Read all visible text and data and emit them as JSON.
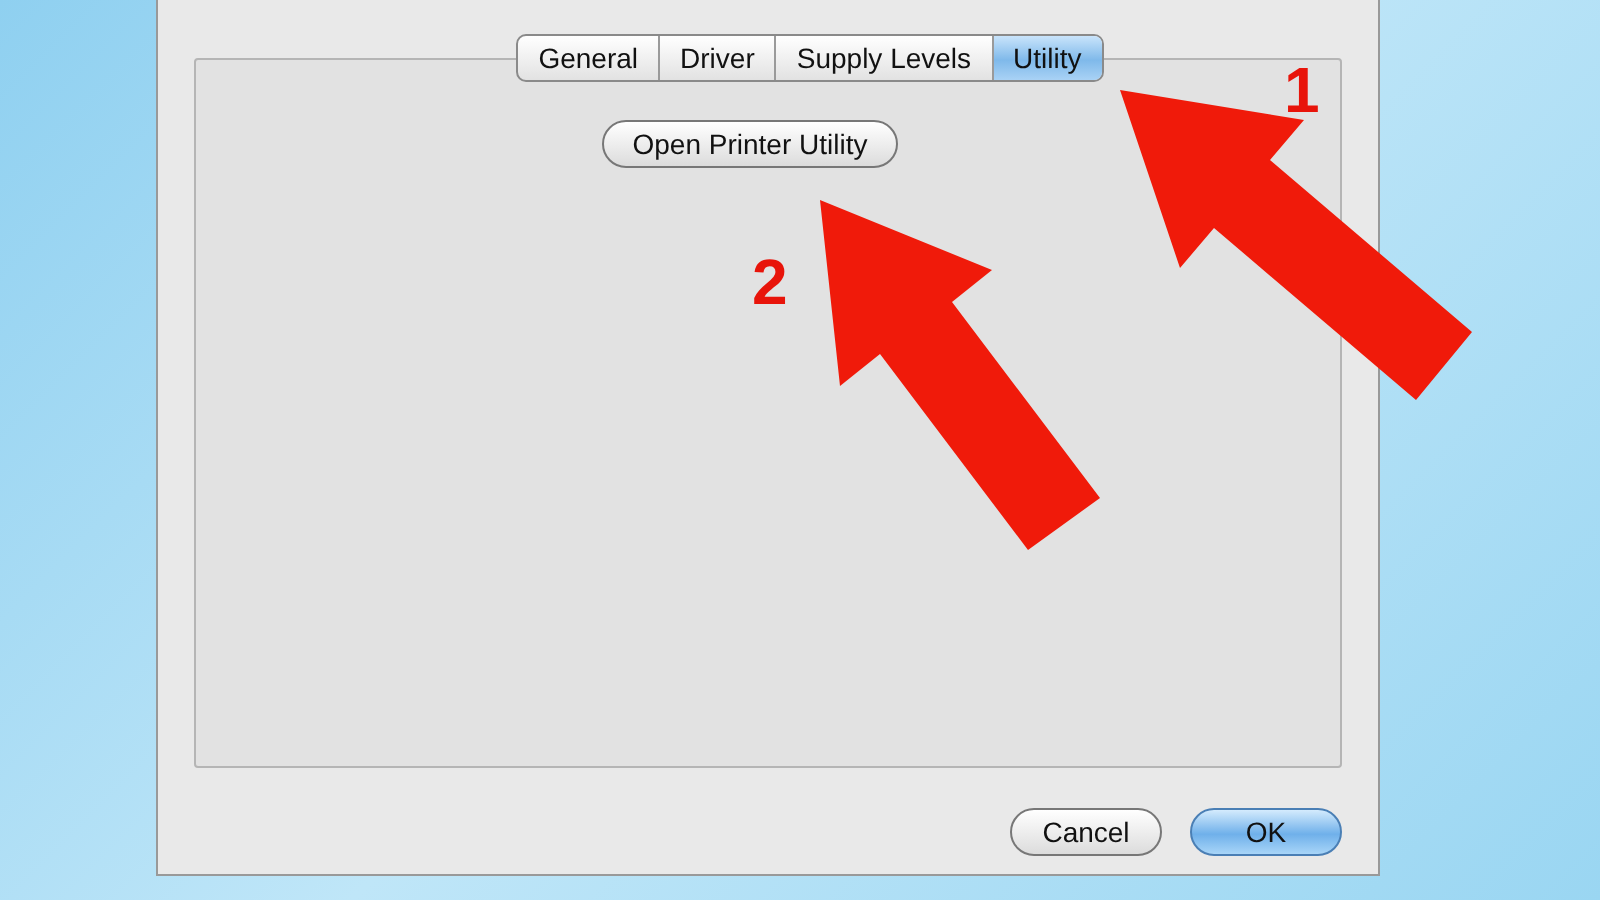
{
  "dialog": {
    "tabs": [
      {
        "label": "General",
        "selected": false
      },
      {
        "label": "Driver",
        "selected": false
      },
      {
        "label": "Supply Levels",
        "selected": false
      },
      {
        "label": "Utility",
        "selected": true
      }
    ],
    "action_button": "Open Printer Utility",
    "buttons": [
      {
        "label": "Cancel",
        "default": false
      },
      {
        "label": "OK",
        "default": true
      }
    ]
  },
  "annotations": [
    {
      "label": "1"
    },
    {
      "label": "2"
    }
  ]
}
